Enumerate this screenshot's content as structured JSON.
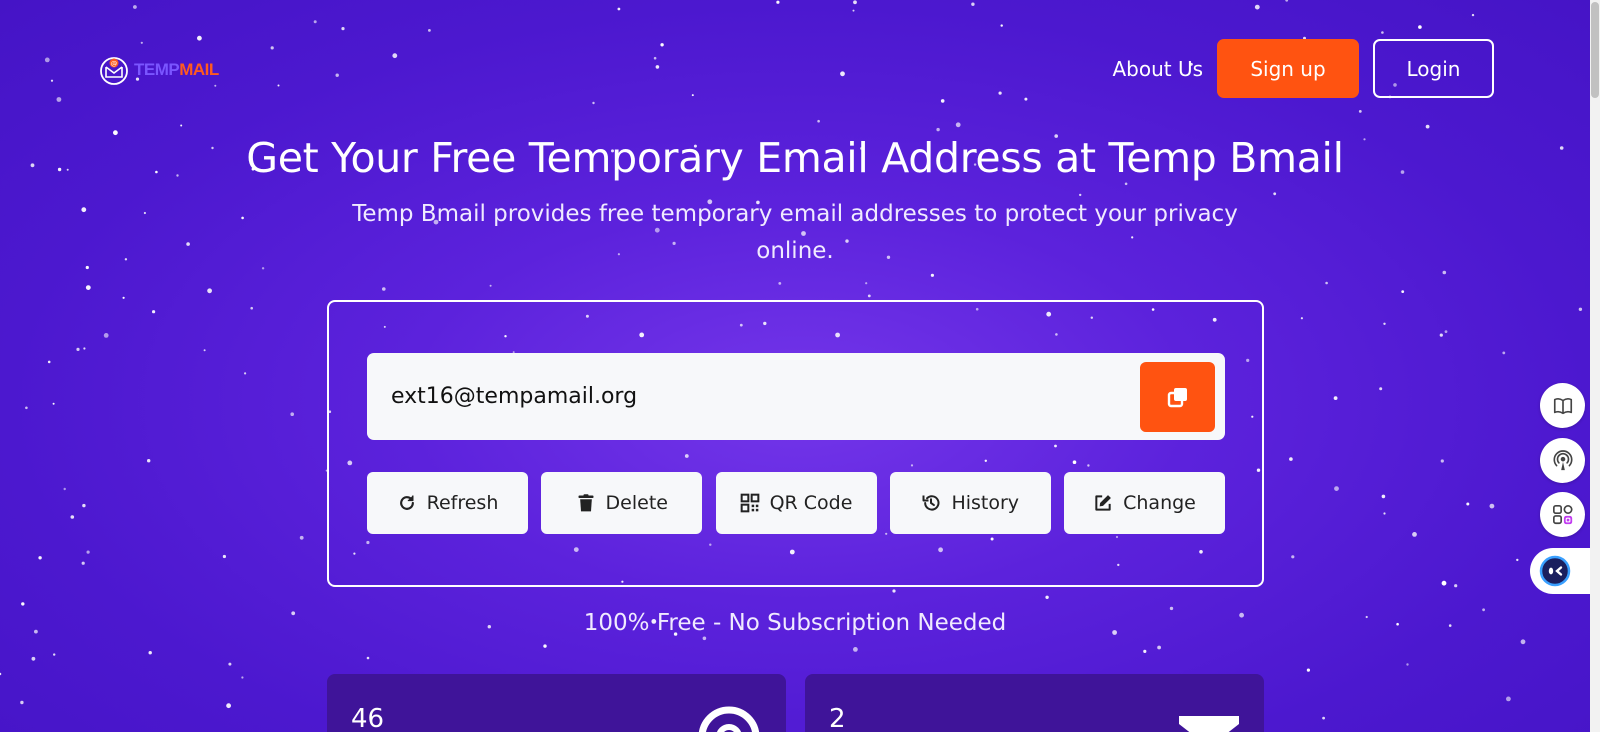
{
  "header": {
    "logo_text_1": "TEMP",
    "logo_text_2": "MAIL",
    "nav_about": "About Us",
    "signup_label": "Sign up",
    "login_label": "Login"
  },
  "hero": {
    "title": "Get Your Free Temporary Email Address at Temp Bmail",
    "subtitle": "Temp Bmail provides free temporary email addresses to protect your privacy online."
  },
  "email_card": {
    "email_value": "ext16@tempamail.org",
    "copy_icon": "copy-icon",
    "actions": [
      {
        "label": "Refresh",
        "icon": "refresh-icon"
      },
      {
        "label": "Delete",
        "icon": "trash-icon"
      },
      {
        "label": "QR Code",
        "icon": "qrcode-icon"
      },
      {
        "label": "History",
        "icon": "history-icon"
      },
      {
        "label": "Change",
        "icon": "edit-icon"
      }
    ]
  },
  "tagline": "100% Free - No Subscription Needed",
  "stats": [
    {
      "value": "46",
      "icon": "email-icon"
    },
    {
      "value": "2",
      "icon": "hourglass-icon"
    }
  ],
  "side_rail": {
    "icons": [
      "book-icon",
      "broadcast-icon",
      "apps-icon",
      "chat-bot-icon"
    ]
  },
  "colors": {
    "background": "#5c22dc",
    "accent": "#ff5311",
    "stat_card": "#3f1499",
    "button_light": "#f7f8fa"
  }
}
